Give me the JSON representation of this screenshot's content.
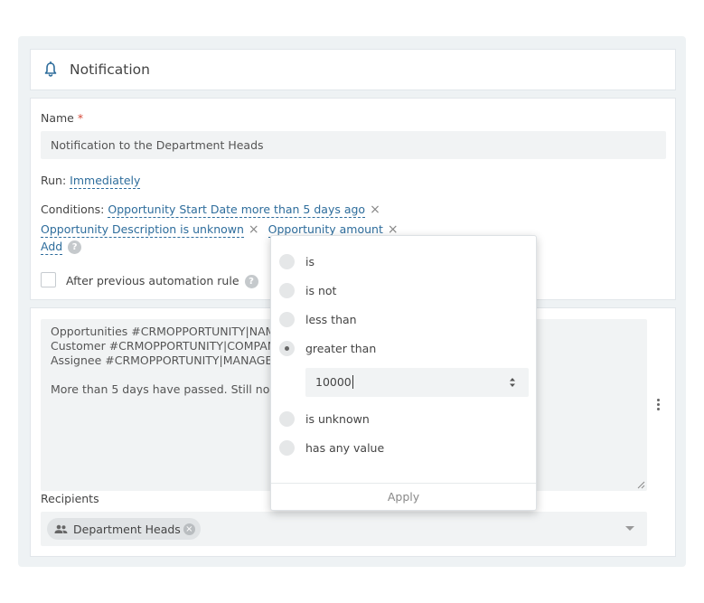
{
  "header": {
    "title": "Notification"
  },
  "form": {
    "name_label": "Name",
    "required_mark": "*",
    "name_value": "Notification to the Department Heads",
    "run_label": "Run:",
    "run_value": "Immediately",
    "conditions_label": "Conditions:",
    "conditions": [
      {
        "text": "Opportunity Start Date more than 5 days ago",
        "remove": "×"
      },
      {
        "text": "Opportunity Description is unknown",
        "remove": "×"
      },
      {
        "text": "Opportunity amount",
        "remove": "×"
      }
    ],
    "add_label": "Add",
    "help_glyph": "?",
    "after_previous_label": "After previous automation rule"
  },
  "message": {
    "text": "Opportunities #CRMOPPORTUNITY|NAME#\nCustomer #CRMOPPORTUNITY|COMPANY#\nAssignee #CRMOPPORTUNITY|MANAGER#\n\nMore than 5 days have passed. Still no information."
  },
  "recipients": {
    "label": "Recipients",
    "chips": [
      {
        "label": "Department Heads",
        "icon": "users-icon"
      }
    ]
  },
  "dropdown": {
    "options": [
      {
        "label": "is",
        "selected": false
      },
      {
        "label": "is not",
        "selected": false
      },
      {
        "label": "less than",
        "selected": false
      },
      {
        "label": "greater than",
        "selected": true
      },
      {
        "label": "is unknown",
        "selected": false
      },
      {
        "label": "has any value",
        "selected": false
      }
    ],
    "input_value": "10000",
    "apply_label": "Apply"
  },
  "colors": {
    "link": "#2e6d9c",
    "required": "#d64a3a",
    "panel_bg": "#eef2f4",
    "input_bg": "#f1f3f4"
  }
}
